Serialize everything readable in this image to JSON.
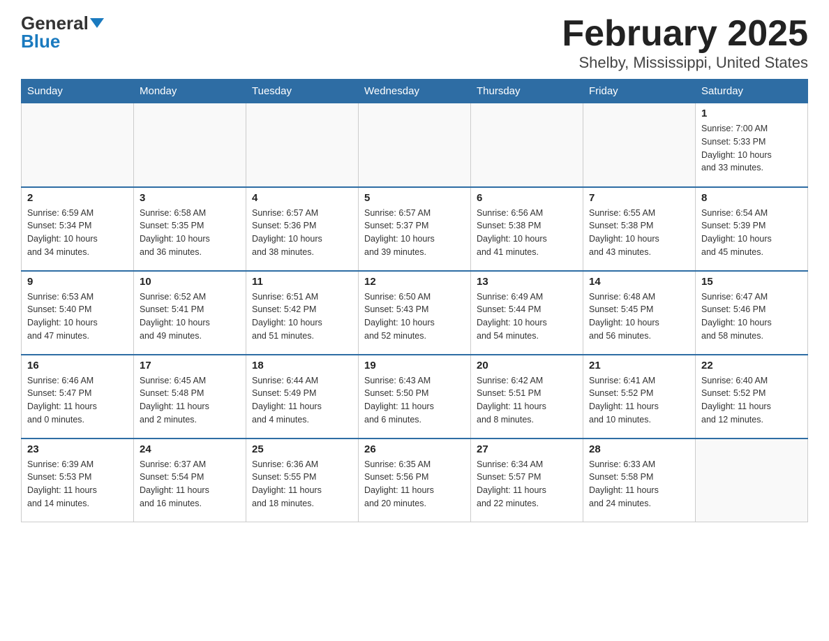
{
  "logo": {
    "general": "General",
    "blue": "Blue"
  },
  "title": "February 2025",
  "subtitle": "Shelby, Mississippi, United States",
  "weekdays": [
    "Sunday",
    "Monday",
    "Tuesday",
    "Wednesday",
    "Thursday",
    "Friday",
    "Saturday"
  ],
  "weeks": [
    [
      {
        "day": "",
        "info": ""
      },
      {
        "day": "",
        "info": ""
      },
      {
        "day": "",
        "info": ""
      },
      {
        "day": "",
        "info": ""
      },
      {
        "day": "",
        "info": ""
      },
      {
        "day": "",
        "info": ""
      },
      {
        "day": "1",
        "info": "Sunrise: 7:00 AM\nSunset: 5:33 PM\nDaylight: 10 hours\nand 33 minutes."
      }
    ],
    [
      {
        "day": "2",
        "info": "Sunrise: 6:59 AM\nSunset: 5:34 PM\nDaylight: 10 hours\nand 34 minutes."
      },
      {
        "day": "3",
        "info": "Sunrise: 6:58 AM\nSunset: 5:35 PM\nDaylight: 10 hours\nand 36 minutes."
      },
      {
        "day": "4",
        "info": "Sunrise: 6:57 AM\nSunset: 5:36 PM\nDaylight: 10 hours\nand 38 minutes."
      },
      {
        "day": "5",
        "info": "Sunrise: 6:57 AM\nSunset: 5:37 PM\nDaylight: 10 hours\nand 39 minutes."
      },
      {
        "day": "6",
        "info": "Sunrise: 6:56 AM\nSunset: 5:38 PM\nDaylight: 10 hours\nand 41 minutes."
      },
      {
        "day": "7",
        "info": "Sunrise: 6:55 AM\nSunset: 5:38 PM\nDaylight: 10 hours\nand 43 minutes."
      },
      {
        "day": "8",
        "info": "Sunrise: 6:54 AM\nSunset: 5:39 PM\nDaylight: 10 hours\nand 45 minutes."
      }
    ],
    [
      {
        "day": "9",
        "info": "Sunrise: 6:53 AM\nSunset: 5:40 PM\nDaylight: 10 hours\nand 47 minutes."
      },
      {
        "day": "10",
        "info": "Sunrise: 6:52 AM\nSunset: 5:41 PM\nDaylight: 10 hours\nand 49 minutes."
      },
      {
        "day": "11",
        "info": "Sunrise: 6:51 AM\nSunset: 5:42 PM\nDaylight: 10 hours\nand 51 minutes."
      },
      {
        "day": "12",
        "info": "Sunrise: 6:50 AM\nSunset: 5:43 PM\nDaylight: 10 hours\nand 52 minutes."
      },
      {
        "day": "13",
        "info": "Sunrise: 6:49 AM\nSunset: 5:44 PM\nDaylight: 10 hours\nand 54 minutes."
      },
      {
        "day": "14",
        "info": "Sunrise: 6:48 AM\nSunset: 5:45 PM\nDaylight: 10 hours\nand 56 minutes."
      },
      {
        "day": "15",
        "info": "Sunrise: 6:47 AM\nSunset: 5:46 PM\nDaylight: 10 hours\nand 58 minutes."
      }
    ],
    [
      {
        "day": "16",
        "info": "Sunrise: 6:46 AM\nSunset: 5:47 PM\nDaylight: 11 hours\nand 0 minutes."
      },
      {
        "day": "17",
        "info": "Sunrise: 6:45 AM\nSunset: 5:48 PM\nDaylight: 11 hours\nand 2 minutes."
      },
      {
        "day": "18",
        "info": "Sunrise: 6:44 AM\nSunset: 5:49 PM\nDaylight: 11 hours\nand 4 minutes."
      },
      {
        "day": "19",
        "info": "Sunrise: 6:43 AM\nSunset: 5:50 PM\nDaylight: 11 hours\nand 6 minutes."
      },
      {
        "day": "20",
        "info": "Sunrise: 6:42 AM\nSunset: 5:51 PM\nDaylight: 11 hours\nand 8 minutes."
      },
      {
        "day": "21",
        "info": "Sunrise: 6:41 AM\nSunset: 5:52 PM\nDaylight: 11 hours\nand 10 minutes."
      },
      {
        "day": "22",
        "info": "Sunrise: 6:40 AM\nSunset: 5:52 PM\nDaylight: 11 hours\nand 12 minutes."
      }
    ],
    [
      {
        "day": "23",
        "info": "Sunrise: 6:39 AM\nSunset: 5:53 PM\nDaylight: 11 hours\nand 14 minutes."
      },
      {
        "day": "24",
        "info": "Sunrise: 6:37 AM\nSunset: 5:54 PM\nDaylight: 11 hours\nand 16 minutes."
      },
      {
        "day": "25",
        "info": "Sunrise: 6:36 AM\nSunset: 5:55 PM\nDaylight: 11 hours\nand 18 minutes."
      },
      {
        "day": "26",
        "info": "Sunrise: 6:35 AM\nSunset: 5:56 PM\nDaylight: 11 hours\nand 20 minutes."
      },
      {
        "day": "27",
        "info": "Sunrise: 6:34 AM\nSunset: 5:57 PM\nDaylight: 11 hours\nand 22 minutes."
      },
      {
        "day": "28",
        "info": "Sunrise: 6:33 AM\nSunset: 5:58 PM\nDaylight: 11 hours\nand 24 minutes."
      },
      {
        "day": "",
        "info": ""
      }
    ]
  ]
}
